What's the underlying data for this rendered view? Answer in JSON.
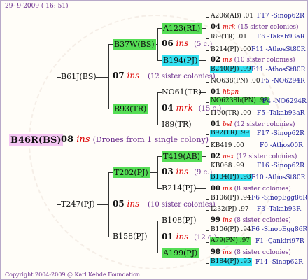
{
  "header": {
    "date": "29-  9-2009 ( 16: 51)"
  },
  "footer": {
    "copyright": "Copyright 2004-2009 @ Karl Kehde Foundation."
  },
  "root": {
    "name": "B46R(BS)",
    "num": "08",
    "ins": "ins",
    "note": "(Drones from 1 single colony)"
  },
  "gen1": {
    "upper": {
      "name": "B61J(BS)",
      "num": "07",
      "ins": "ins",
      "note": "(12 sister colonies)"
    },
    "lower": {
      "name": "T247(PJ)",
      "num": "05",
      "ins": "ins",
      "note": "(10 sister colonies)"
    }
  },
  "gen2": {
    "b37w": {
      "name": "B37W(BS)",
      "num": "06",
      "ins": "ins",
      "note": "(5 c.)"
    },
    "b93": {
      "name": "B93(TR)",
      "num": "04",
      "ins": "mrk",
      "note": "(15 c.)"
    },
    "t202": {
      "name": "T202(PJ)",
      "num": "03",
      "ins": "ins",
      "note": "(9 c.)"
    },
    "b158": {
      "name": "B158(PJ)",
      "num": "01",
      "ins": "ins",
      "note": "(12 c.)"
    }
  },
  "gen3": {
    "a123": {
      "name": "A123(RL)"
    },
    "b194": {
      "name": "B194(PJ)"
    },
    "no61": {
      "name": "NO61(TR)"
    },
    "i89": {
      "name": "I89(TR)"
    },
    "t419": {
      "name": "T419(AB)"
    },
    "b214": {
      "name": "B214(PJ)"
    },
    "b108": {
      "name": "B108(PJ)"
    },
    "a199": {
      "name": "A199(PJ)"
    }
  },
  "gen4": {
    "g1": {
      "top": "A206(AB) .01",
      "top_src": "F17 -Sinop62R",
      "num": "04",
      "ins": "mrk",
      "note": "(15 sister colonies)",
      "bottom": "I89(TR) .01",
      "bottom_src": "F6 -Takab93aR"
    },
    "g2": {
      "top": "B214(PJ) .00",
      "top_src": "F11 -AthosSt80R",
      "num": "02",
      "ins": "ins",
      "note": "(10 sister colonies)",
      "bottom": "B240(PJ) .99",
      "bottom_src": "F11 -AthosSt80R"
    },
    "g3": {
      "top": "NO638(PN) .00",
      "top_src": "F5 -NO6294R",
      "num": "01",
      "ins": "hbpn",
      "note": "",
      "bottom": "NO6238b(PN) .98",
      "bottom_src": "F4 -NO6294R"
    },
    "g4": {
      "top": "I100(TR) .00",
      "top_src": "F5 -Takab93aR",
      "num": "01",
      "ins": "bsl",
      "note": "(12 sister colonies)",
      "bottom": "B92(TR) .99",
      "bottom_src": "F17 -Sinop62R"
    },
    "g5": {
      "top": "KB419 .00",
      "top_src": "F0 -Athos00R",
      "num": "02",
      "ins": "nex",
      "note": "(12 sister colonies)",
      "bottom": "KB068 .99",
      "bottom_src": "F16 -Sinop62R"
    },
    "g6": {
      "top": "B134(PJ) .98",
      "top_src": "F10 -AthosSt80R",
      "num": "00",
      "ins": "ins",
      "note": "(8 sister colonies)",
      "bottom": "B106(PJ) .94",
      "bottom_src": "F6 -SinopEgg86R"
    },
    "g7": {
      "top": "I232(PJ) .97",
      "top_src": "F3 -Takab93R",
      "num": "99",
      "ins": "ins",
      "note": "(8 sister colonies)",
      "bottom": "B106(PJ) .94",
      "bottom_src": "F6 -SinopEgg86R"
    },
    "g8": {
      "top": "A79(PN) .97",
      "top_src": "F1 -Çankiri97R",
      "num": "98",
      "ins": "ins",
      "note": "(8 sister colonies)",
      "bottom": "B184(PJ) .95",
      "bottom_src": "F14 -Sinop62R"
    }
  }
}
